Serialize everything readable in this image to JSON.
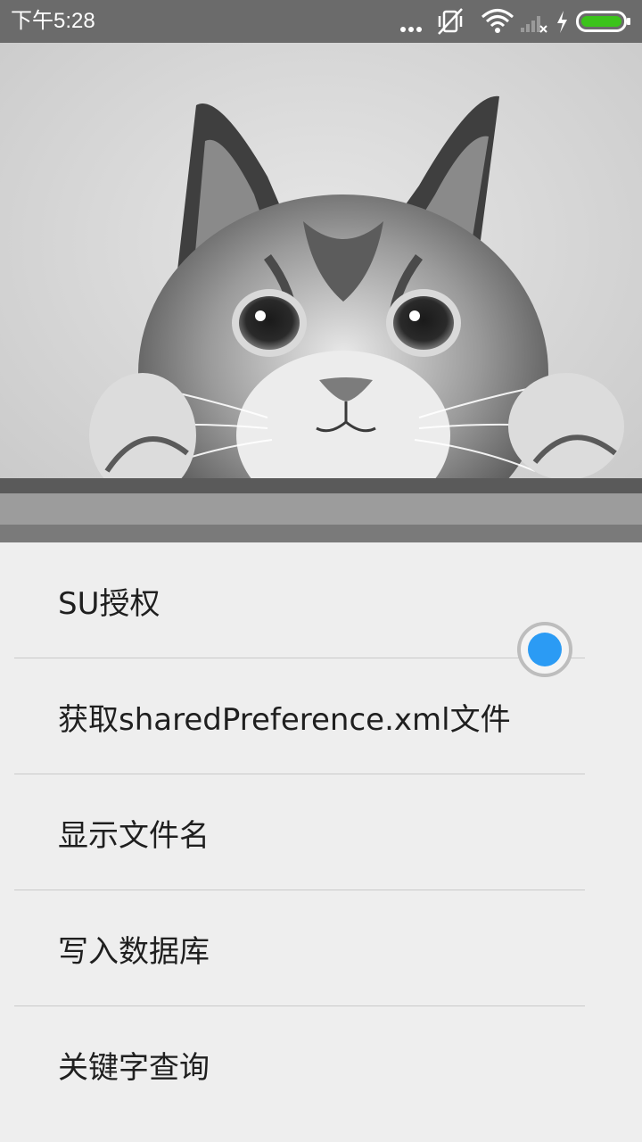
{
  "status_bar": {
    "time": "下午5:28",
    "icons": [
      "more-dots-icon",
      "vibrate-off-icon",
      "wifi-icon",
      "signal-off-icon",
      "charging-icon",
      "battery-icon"
    ],
    "battery_color": "#3cc31b"
  },
  "header_image": {
    "subject": "cat-photo"
  },
  "menu": {
    "items": [
      {
        "label": "SU授权"
      },
      {
        "label": "获取sharedPreference.xml文件"
      },
      {
        "label": "显示文件名"
      },
      {
        "label": "写入数据库"
      },
      {
        "label": "关键字查询"
      }
    ]
  },
  "floating_button": {
    "color": "#2b9bf4"
  }
}
